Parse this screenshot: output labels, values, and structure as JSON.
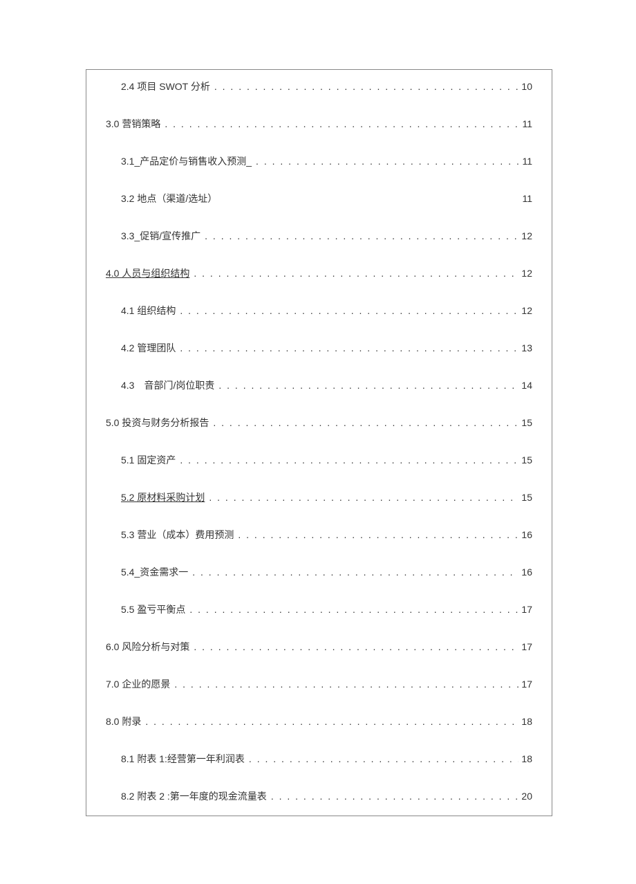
{
  "toc": [
    {
      "level": 2,
      "label": "2.4 项目 SWOT 分析",
      "page": "10",
      "underline": false,
      "solid": false
    },
    {
      "level": 1,
      "label": "3.0 营销策略",
      "page": "11",
      "underline": false,
      "solid": false
    },
    {
      "level": 2,
      "label": "3.1_产品定价与销售收入预测_",
      "page": "11",
      "underline": false,
      "solid": false
    },
    {
      "level": 2,
      "label": "3.2 地点（渠道/选址）",
      "page": "11",
      "underline": false,
      "solid": true
    },
    {
      "level": 2,
      "label": "3.3_促销/宣传推广",
      "page": "12",
      "underline": false,
      "solid": false
    },
    {
      "level": 1,
      "label": "4.0 人员与组织结构",
      "page": "12",
      "underline": true,
      "solid": false
    },
    {
      "level": 2,
      "label": "4.1 组织结构",
      "page": "12",
      "underline": false,
      "solid": false
    },
    {
      "level": 2,
      "label": "4.2 管理团队",
      "page": "13",
      "underline": false,
      "solid": false
    },
    {
      "level": 2,
      "label": "4.3 音部门/岗位职责",
      "page": "14",
      "underline": false,
      "solid": false
    },
    {
      "level": 1,
      "label": "5.0 投资与财务分析报告",
      "page": "15",
      "underline": false,
      "solid": false
    },
    {
      "level": 2,
      "label": "5.1 固定资产",
      "page": "15",
      "underline": false,
      "solid": false
    },
    {
      "level": 2,
      "label": "5.2 原材料采购计划",
      "page": "15",
      "underline": true,
      "solid": false
    },
    {
      "level": 2,
      "label": "5.3 营业（成本）费用预测",
      "page": "16",
      "underline": false,
      "solid": false
    },
    {
      "level": 2,
      "label": "5.4_资金需求一",
      "page": "16",
      "underline": false,
      "solid": false
    },
    {
      "level": 2,
      "label": "5.5 盈亏平衡点",
      "page": "17",
      "underline": false,
      "solid": false
    },
    {
      "level": 1,
      "label": "6.0 风险分析与对策",
      "page": "17",
      "underline": false,
      "solid": false
    },
    {
      "level": 1,
      "label": "7.0 企业的愿景",
      "page": "17",
      "underline": false,
      "solid": false
    },
    {
      "level": 1,
      "label": "8.0 附录",
      "page": "18",
      "underline": false,
      "solid": false
    },
    {
      "level": 2,
      "label": "8.1 附表 1:经营第一年利润表",
      "page": "18",
      "underline": false,
      "solid": false
    },
    {
      "level": 2,
      "label": "8.2 附表 2 :第一年度的现金流量表",
      "page": "20",
      "underline": false,
      "solid": false
    }
  ]
}
